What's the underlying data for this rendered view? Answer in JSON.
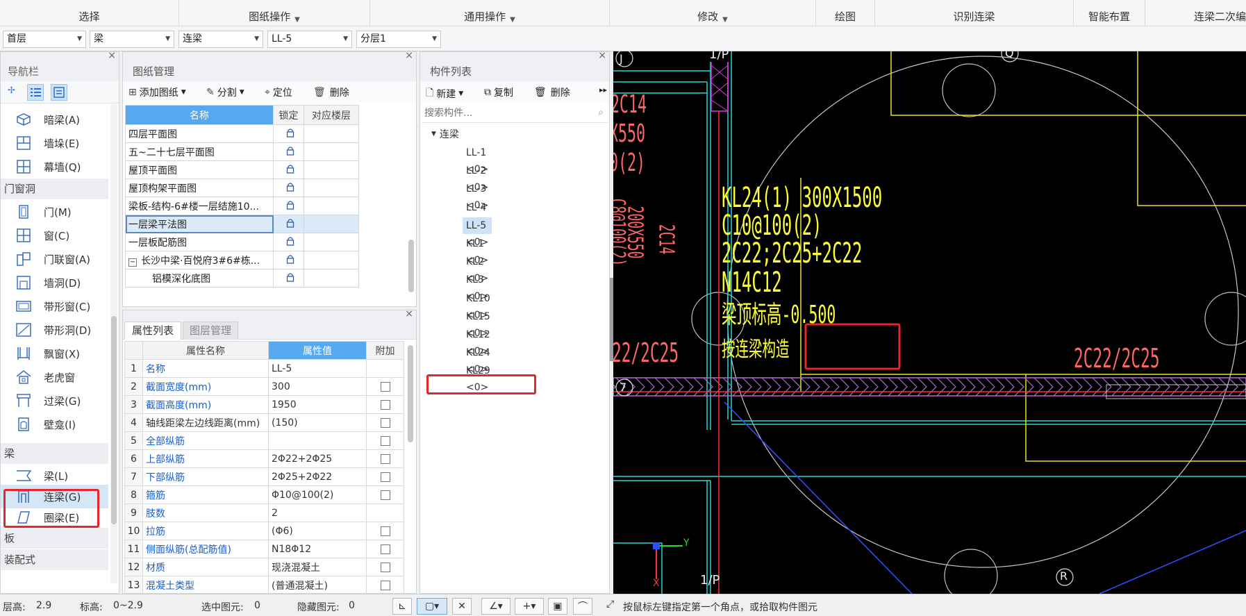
{
  "ribbon": {
    "groups": [
      "选择",
      "图纸操作",
      "通用操作",
      "修改",
      "绘图",
      "识别连梁",
      "智能布置",
      "连梁二次编"
    ]
  },
  "selectors": {
    "floor": "首层",
    "category": "梁",
    "type": "连梁",
    "component": "LL-5",
    "layer": "分层1"
  },
  "nav": {
    "title": "导航栏",
    "items_top": [
      "暗梁(A)",
      "墙垛(E)",
      "幕墙(Q)"
    ],
    "section_door": "门窗洞",
    "door_items": [
      "门(M)",
      "窗(C)",
      "门联窗(A)",
      "墙洞(D)",
      "带形窗(C)",
      "带形洞(D)",
      "飘窗(X)",
      "老虎窗",
      "过梁(G)",
      "壁龛(I)"
    ],
    "section_beam": "梁",
    "beam_items": [
      "梁(L)",
      "连梁(G)",
      "圈梁(E)"
    ],
    "section_slab": "板",
    "section_prefab": "装配式"
  },
  "drawings": {
    "title": "图纸管理",
    "toolbar": {
      "add": "添加图纸",
      "split": "分割",
      "locate": "定位",
      "delete": "删除"
    },
    "headers": {
      "name": "名称",
      "lock": "锁定",
      "floor": "对应楼层"
    },
    "rows": [
      "四层平面图",
      "五~二十七层平面图",
      "屋顶平面图",
      "屋顶构架平面图",
      "梁板-结构-6#楼一层结施10...",
      "一层梁平法图",
      "一层板配筋图",
      "长沙中梁·百悦府3#6#栋...",
      "铝模深化底图"
    ]
  },
  "properties": {
    "tab_active": "属性列表",
    "tab_other": "图层管理",
    "headers": {
      "name": "属性名称",
      "value": "属性值",
      "extra": "附加"
    },
    "rows": [
      {
        "n": "1",
        "k": "名称",
        "v": "LL-5",
        "cb": false
      },
      {
        "n": "2",
        "k": "截面宽度(mm)",
        "v": "300",
        "cb": true
      },
      {
        "n": "3",
        "k": "截面高度(mm)",
        "v": "1950",
        "cb": true
      },
      {
        "n": "4",
        "k": "轴线距梁左边线距离(mm)",
        "v": "(150)",
        "cb": true,
        "black": true
      },
      {
        "n": "5",
        "k": "全部纵筋",
        "v": "",
        "cb": true
      },
      {
        "n": "6",
        "k": "上部纵筋",
        "v": "2Φ22+2Φ25",
        "cb": true
      },
      {
        "n": "7",
        "k": "下部纵筋",
        "v": "2Φ25+2Φ22",
        "cb": true
      },
      {
        "n": "8",
        "k": "箍筋",
        "v": "Φ10@100(2)",
        "cb": true
      },
      {
        "n": "9",
        "k": "肢数",
        "v": "2",
        "cb": false
      },
      {
        "n": "10",
        "k": "拉筋",
        "v": "(Φ6)",
        "cb": true
      },
      {
        "n": "11",
        "k": "侧面纵筋(总配筋值)",
        "v": "N18Φ12",
        "cb": true
      },
      {
        "n": "12",
        "k": "材质",
        "v": "现浇混凝土",
        "cb": true
      },
      {
        "n": "13",
        "k": "混凝土类型",
        "v": "(普通混凝土)",
        "cb": true
      }
    ]
  },
  "components": {
    "title": "构件列表",
    "toolbar": {
      "new": "新建",
      "copy": "复制",
      "delete": "删除"
    },
    "search_placeholder": "搜索构件...",
    "group": "连梁",
    "items": [
      "LL-1 <0>",
      "LL-2 <0>",
      "LL-3 <0>",
      "LL-4 <0>",
      "LL-5 <0>",
      "KL1 <0>",
      "KL2 <0>",
      "KL3 <0>",
      "KL10 <0>",
      "KL15 <0>",
      "KL12 <0>",
      "KL24 <0>",
      "KL29 <0>"
    ]
  },
  "cad": {
    "axis_j": "J",
    "axis_1p_top": "1/P",
    "axis_q": "Q",
    "axis_7": "7",
    "axis_1p_bottom": "1/P",
    "axis_r": "R",
    "red_texts": [
      "2C14",
      "X550",
      "0(2)",
      "C8@100(2)",
      "200X550",
      "2C14",
      "22/2C25",
      "2C22/2C25"
    ],
    "beam_lines": [
      "KL24(1) 300X1500",
      "C10@100(2)",
      "2C22;2C25+2C22",
      "N14C12",
      "梁顶标高-0.500"
    ],
    "note": "按连梁构造",
    "ucs_x": "X",
    "ucs_y": "Y"
  },
  "status": {
    "floor_height_label": "层高:",
    "floor_height": "2.9",
    "elev_label": "标高:",
    "elev": "0~2.9",
    "selected_label": "选中图元:",
    "selected": "0",
    "hidden_label": "隐藏图元:",
    "hidden": "0",
    "hint": "按鼠标左键指定第一个角点，或拾取构件图元"
  },
  "colors": {
    "accent": "#58a8f0",
    "highlight_box": "#e6262a",
    "cad_bg": "#000000",
    "cad_yellow": "#ffff33",
    "cad_red": "#ff6666"
  }
}
